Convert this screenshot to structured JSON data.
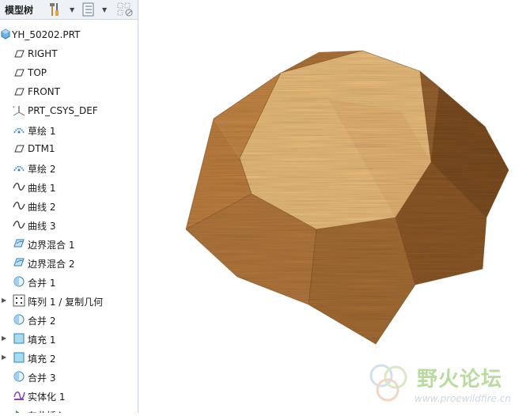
{
  "panel": {
    "title": "模型树"
  },
  "toolbar_icons": [
    "tools-icon",
    "dropdown-arrow-icon",
    "tree-settings-icon",
    "dropdown-arrow-icon",
    "tree-filter-icon"
  ],
  "tree": {
    "root": {
      "label": "YH_50202.PRT",
      "icon": "part-icon"
    },
    "items": [
      {
        "label": "RIGHT",
        "icon": "datum-plane-icon",
        "expandable": false
      },
      {
        "label": "TOP",
        "icon": "datum-plane-icon",
        "expandable": false
      },
      {
        "label": "FRONT",
        "icon": "datum-plane-icon",
        "expandable": false
      },
      {
        "label": "PRT_CSYS_DEF",
        "icon": "csys-icon",
        "expandable": false
      },
      {
        "label": "草绘 1",
        "icon": "sketch-icon",
        "expandable": false
      },
      {
        "label": "DTM1",
        "icon": "datum-plane-icon",
        "expandable": false
      },
      {
        "label": "草绘 2",
        "icon": "sketch-icon",
        "expandable": false
      },
      {
        "label": "曲线 1",
        "icon": "curve-icon",
        "expandable": false
      },
      {
        "label": "曲线 2",
        "icon": "curve-icon",
        "expandable": false
      },
      {
        "label": "曲线 3",
        "icon": "curve-icon",
        "expandable": false
      },
      {
        "label": "边界混合 1",
        "icon": "boundary-blend-icon",
        "expandable": false
      },
      {
        "label": "边界混合 2",
        "icon": "boundary-blend-icon",
        "expandable": false
      },
      {
        "label": "合并 1",
        "icon": "merge-icon",
        "expandable": false
      },
      {
        "label": "阵列 1 / 复制几何",
        "icon": "pattern-icon",
        "expandable": true
      },
      {
        "label": "合并 2",
        "icon": "merge-icon",
        "expandable": false
      },
      {
        "label": "填充 1",
        "icon": "fill-icon",
        "expandable": true
      },
      {
        "label": "填充 2",
        "icon": "fill-icon",
        "expandable": true
      },
      {
        "label": "合并 3",
        "icon": "merge-icon",
        "expandable": false
      },
      {
        "label": "实体化 1",
        "icon": "solidify-icon",
        "expandable": false
      },
      {
        "label": "在此插入",
        "icon": "insert-here-icon",
        "expandable": false
      }
    ]
  },
  "watermark": {
    "name": "野火论坛",
    "url": "www.proewildfire.cn"
  },
  "colors": {
    "wood_light": "#f0c27e",
    "wood_mid": "#c98c4a",
    "wood_dark": "#8a5520",
    "tree_icon_blue": "#2f7fb8"
  }
}
